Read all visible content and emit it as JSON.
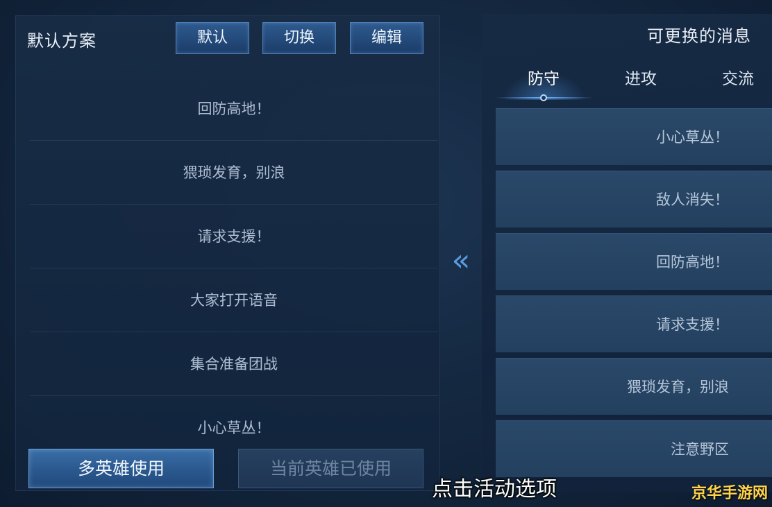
{
  "left_panel": {
    "title": "默认方案",
    "header_buttons": {
      "default": "默认",
      "switch": "切换",
      "edit": "编辑"
    },
    "messages": [
      "回防高地！",
      "猥琐发育，别浪",
      "请求支援！",
      "大家打开语音",
      "集合准备团战",
      "小心草丛！"
    ],
    "bottom_buttons": {
      "multi_hero": "多英雄使用",
      "current_hero_used": "当前英雄已使用"
    }
  },
  "transfer_arrow": "«",
  "right_panel": {
    "title": "可更换的消息",
    "tabs": [
      {
        "label": "防守",
        "active": true
      },
      {
        "label": "进攻",
        "active": false
      },
      {
        "label": "交流",
        "active": false
      }
    ],
    "messages": [
      "小心草丛！",
      "敌人消失！",
      "回防高地！",
      "请求支援！",
      "猥琐发育，别浪",
      "注意野区"
    ]
  },
  "overlay": {
    "caption": "点击活动选项",
    "watermark": "京华手游网"
  },
  "colors": {
    "accent": "#5a9be0",
    "button_blue": "#2b5a90",
    "watermark": "#ffd24a"
  }
}
